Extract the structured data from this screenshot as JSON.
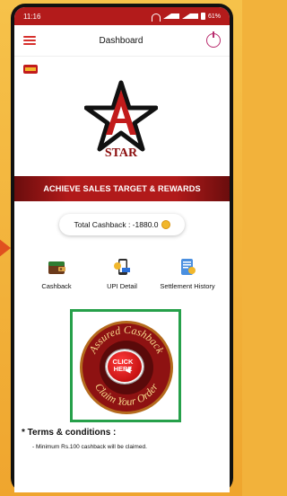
{
  "status_bar": {
    "time": "11:16",
    "battery": "61%"
  },
  "header": {
    "title": "Dashboard"
  },
  "brand": {
    "logo_text": "STAR",
    "mini_logo": "BV"
  },
  "banner": {
    "text": "ACHIEVE SALES TARGET & REWARDS"
  },
  "cashback": {
    "label": "Total Cashback : -1880.0"
  },
  "tiles": [
    {
      "label": "Cashback",
      "icon": "wallet-icon"
    },
    {
      "label": "UPI Detail",
      "icon": "upi-phone-icon"
    },
    {
      "label": "Settlement History",
      "icon": "receipt-icon"
    }
  ],
  "claim": {
    "top_text": "Assured Cashback",
    "bottom_text": "Claim Your Order",
    "button_text_1": "CLICK",
    "button_text_2": "HERE"
  },
  "terms": {
    "title": "* Terms & conditions :",
    "items": [
      "- Minimum Rs.100 cashback will be claimed."
    ]
  },
  "colors": {
    "brand_red": "#b31b1b",
    "highlight_green": "#26a04a",
    "background": "#f2b23b"
  }
}
